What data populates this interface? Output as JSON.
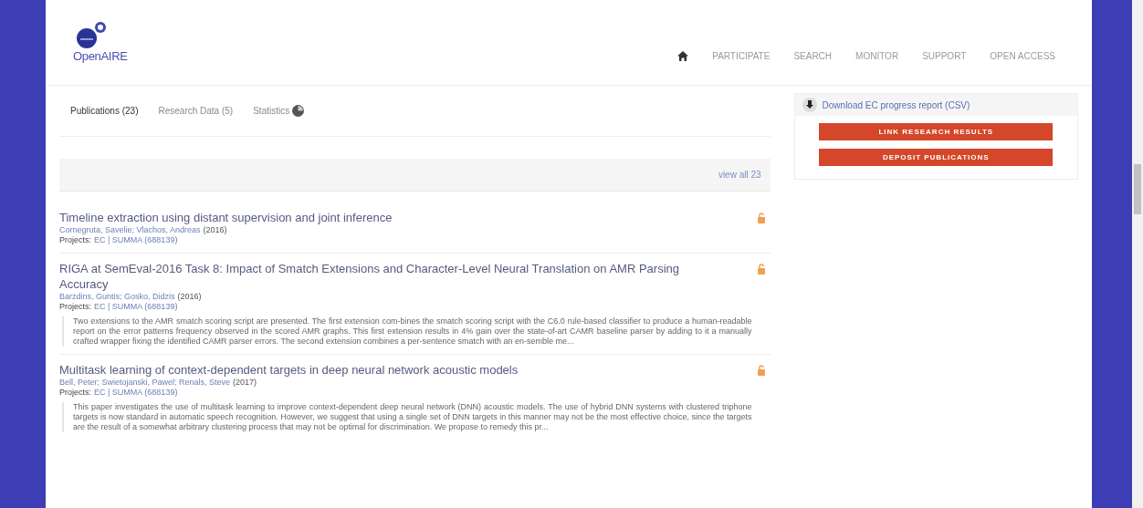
{
  "logo": {
    "text": "OpenAIRE"
  },
  "nav": [
    "PARTICIPATE",
    "SEARCH",
    "MONITOR",
    "SUPPORT",
    "OPEN ACCESS"
  ],
  "tabs": [
    {
      "label": "Publications (23)",
      "selected": true
    },
    {
      "label": "Research Data (5)",
      "selected": false
    },
    {
      "label": "Statistics",
      "selected": false
    }
  ],
  "view_all": "view all 23",
  "results": [
    {
      "title": "Timeline extraction using distant supervision and joint inference",
      "authors": "Cornegruta, Savelie; Vlachos, Andreas",
      "year": "(2016)",
      "projects_label": "Projects:",
      "projects": "EC | SUMMA (688139)"
    },
    {
      "title": "RIGA at SemEval-2016 Task 8: Impact of Smatch Extensions and Character-Level Neural Translation on AMR Parsing Accuracy",
      "authors": "Barzdins, Guntis; Gosko, Didzis",
      "year": "(2016)",
      "projects_label": "Projects:",
      "projects": "EC | SUMMA (688139)",
      "abstract": "Two extensions to the AMR smatch scoring script are presented. The first extension com-bines the smatch scoring script with the C6.0 rule-based classifier to produce a human-readable report on the error patterns frequency observed in the scored AMR graphs. This first extension results in 4% gain over the state-of-art CAMR baseline parser by adding to it a manually crafted wrapper fixing the identified CAMR parser errors. The second extension combines a per-sentence smatch with an en-semble me..."
    },
    {
      "title": "Multitask learning of context-dependent targets in deep neural network acoustic models",
      "authors": "Bell, Peter; Swietojanski, Pawel; Renals, Steve",
      "year": "(2017)",
      "projects_label": "Projects:",
      "projects": "EC | SUMMA (688139)",
      "abstract": "This paper investigates the use of multitask learning to improve context-dependent deep neural network (DNN) acoustic models. The use of hybrid DNN systems with clustered triphone targets is now standard in automatic speech recognition. However, we suggest that using a single set of DNN targets in this manner may not be the most effective choice, since the targets are the result of a somewhat arbitrary clustering process that may not be optimal for discrimination. We propose to remedy this pr..."
    }
  ],
  "sidebar": {
    "download": "Download EC progress report (CSV)",
    "buttons": [
      "LINK RESEARCH RESULTS",
      "DEPOSIT PUBLICATIONS"
    ]
  }
}
